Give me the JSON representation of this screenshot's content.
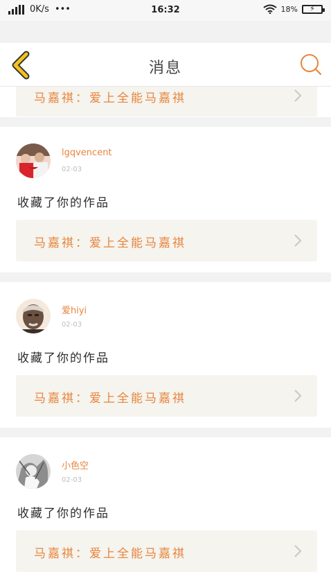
{
  "status_bar": {
    "network_speed": "0K/s",
    "dots": "•••",
    "time": "16:32",
    "battery_percent": "18%",
    "battery_icon": "battery-charging-icon"
  },
  "header": {
    "title": "消息",
    "back_icon": "chevron-left-icon",
    "search_icon": "search-icon"
  },
  "partial_item": {
    "work_title": "马嘉祺：爱上全能马嘉祺"
  },
  "items": [
    {
      "username": "lgqvencent",
      "date": "02-03",
      "action": "收藏了你的作品",
      "work_title": "马嘉祺：爱上全能马嘉祺"
    },
    {
      "username": "爱hiyi",
      "date": "02-03",
      "action": "收藏了你的作品",
      "work_title": "马嘉祺：爱上全能马嘉祺"
    },
    {
      "username": "小色空",
      "date": "02-03",
      "action": "收藏了你的作品",
      "work_title": "马嘉祺：爱上全能马嘉祺"
    }
  ],
  "colors": {
    "accent": "#e8843d",
    "back_icon": "#f3c21b",
    "card_bg": "#ffffff",
    "work_box_bg": "#f5f4ee"
  }
}
